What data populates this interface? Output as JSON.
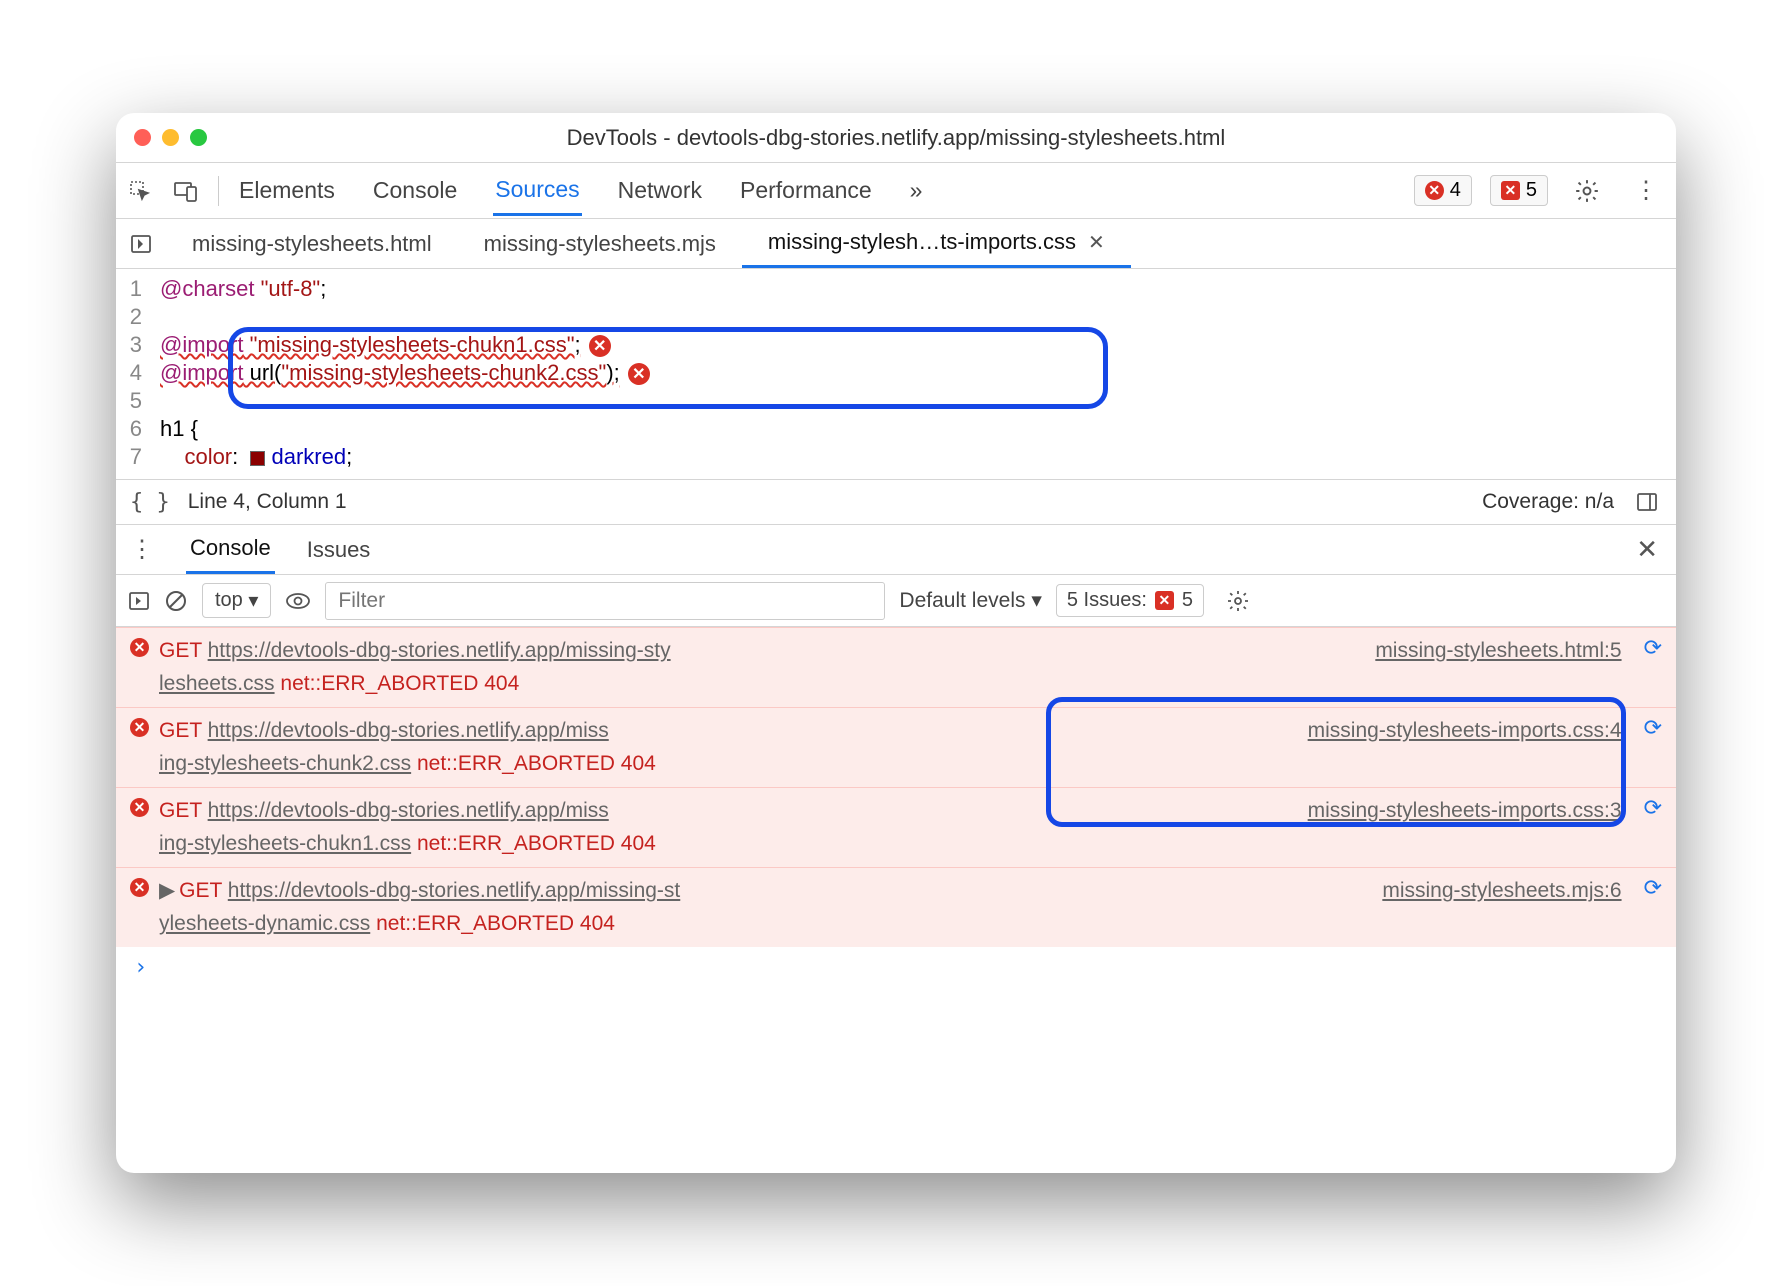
{
  "window_title": "DevTools - devtools-dbg-stories.netlify.app/missing-stylesheets.html",
  "panels": [
    "Elements",
    "Console",
    "Sources",
    "Network",
    "Performance"
  ],
  "active_panel": "Sources",
  "more_panels": "»",
  "error_count": "4",
  "issue_count": "5",
  "file_tabs": {
    "tab1": "missing-stylesheets.html",
    "tab2": "missing-stylesheets.mjs",
    "tab3": "missing-stylesh…ts-imports.css"
  },
  "code": {
    "l1a": "@charset",
    "l1b": " \"utf-8\"",
    "l1c": ";",
    "l3a": "@import",
    "l3b": " \"missing-stylesheets-chukn1.css\"",
    "l3c": ";",
    "l4a": "@import",
    "l4b": " url(",
    "l4c": "\"missing-stylesheets-chunk2.css\"",
    "l4d": ");",
    "l6": "h1 {",
    "l7a": "    ",
    "l7b": "color",
    "l7c": ":  ",
    "l7d": "darkred",
    "l7e": ";"
  },
  "line_numbers": [
    "1",
    "2",
    "3",
    "4",
    "5",
    "6",
    "7"
  ],
  "status": {
    "cursor": "Line 4, Column 1",
    "coverage": "Coverage: n/a"
  },
  "drawer": {
    "console": "Console",
    "issues": "Issues"
  },
  "console_toolbar": {
    "context": "top",
    "filter_placeholder": "Filter",
    "levels": "Default levels",
    "issues_label": "5 Issues:",
    "issues_count": "5"
  },
  "messages": [
    {
      "get": "GET ",
      "url": "https://devtools-dbg-stories.netlify.app/missing-stylesheets.css",
      "url1": "https://devtools-dbg-stories.netlify.app/missing-sty",
      "url2": "lesheets.css",
      "err": " net::ERR_ABORTED 404",
      "src": "missing-stylesheets.html:5"
    },
    {
      "get": "GET ",
      "url1": "https://devtools-dbg-stories.netlify.app/miss",
      "url2": "ing-stylesheets-chunk2.css",
      "err": " net::ERR_ABORTED 404",
      "src": "missing-stylesheets-imports.css:4"
    },
    {
      "get": "GET ",
      "url1": "https://devtools-dbg-stories.netlify.app/miss",
      "url2": "ing-stylesheets-chukn1.css",
      "err": " net::ERR_ABORTED 404",
      "src": "missing-stylesheets-imports.css:3"
    },
    {
      "get": "GET ",
      "url1": "https://devtools-dbg-stories.netlify.app/missing-st",
      "url2": "ylesheets-dynamic.css",
      "err": " net::ERR_ABORTED 404",
      "src": "missing-stylesheets.mjs:6",
      "expandable": true
    }
  ]
}
